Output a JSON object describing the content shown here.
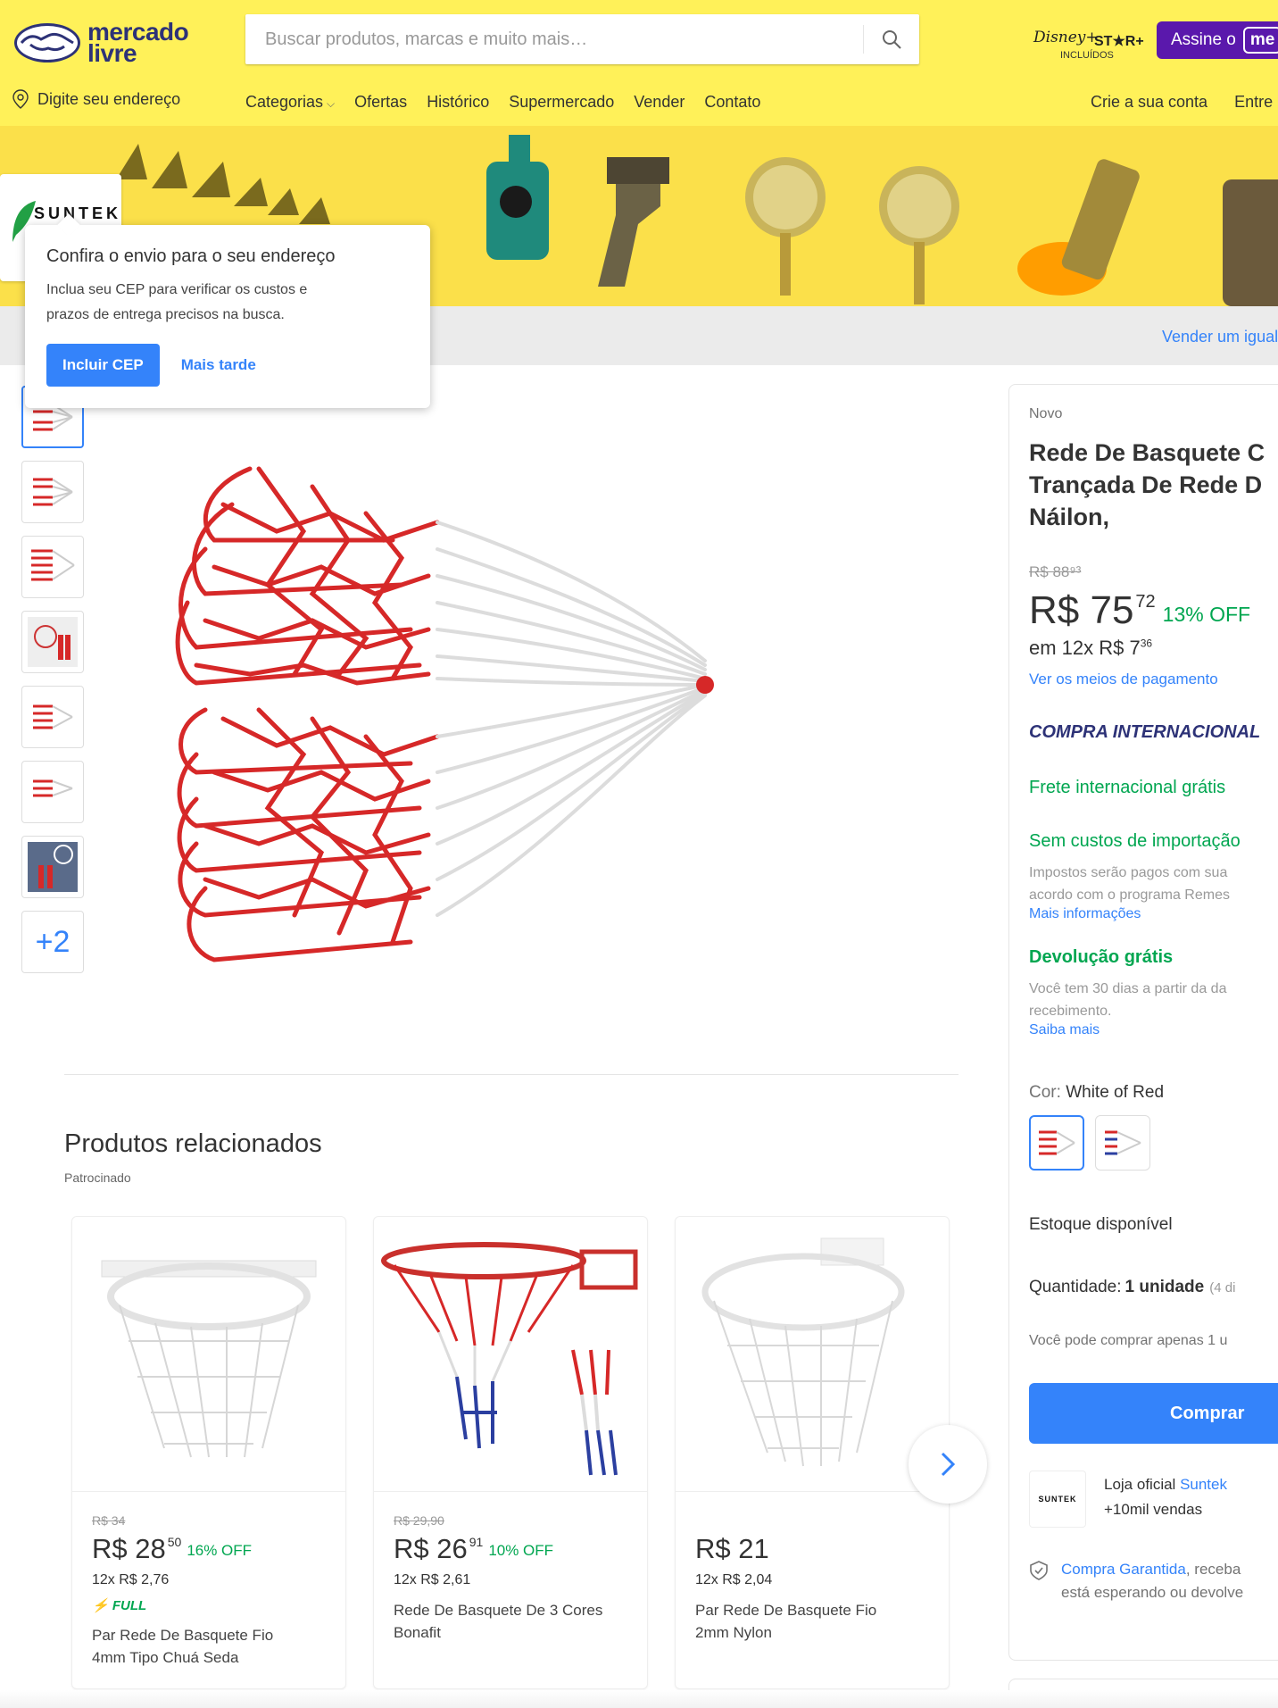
{
  "header": {
    "logo_line1": "mercado",
    "logo_line2": "livre",
    "search_placeholder": "Buscar produtos, marcas e muito mais…",
    "disney_brand": "Disney+",
    "star_brand": "ST★R+",
    "included": "INCLUÍDOS",
    "subscribe_label": "Assine o",
    "subscribe_badge": "me",
    "location_label": "Digite seu endereço",
    "nav": [
      "Categorias",
      "Ofertas",
      "Histórico",
      "Supermercado",
      "Vender",
      "Contato"
    ],
    "create_account": "Crie a sua conta",
    "login": "Entre"
  },
  "banner": {
    "store_name": "SUNTEK",
    "sell_similar": "Vender um igual"
  },
  "popup": {
    "title": "Confira o envio para o seu endereço",
    "text_line1": "Inclua seu CEP para verificar os custos e",
    "text_line2": "prazos de entrega precisos na busca.",
    "primary_button": "Incluir CEP",
    "secondary_button": "Mais tarde"
  },
  "gallery": {
    "more_count": "+2"
  },
  "related": {
    "title": "Produtos relacionados",
    "sponsored": "Patrocinado",
    "items": [
      {
        "old_price": "R$ 34",
        "price_int": "R$ 28",
        "price_cents": "50",
        "off": "16% OFF",
        "installments": "12x R$ 2,76",
        "full": "FULL",
        "name_line1": "Par Rede De Basquete Fio",
        "name_line2": "4mm Tipo Chuá Seda"
      },
      {
        "old_price": "R$ 29,90",
        "price_int": "R$ 26",
        "price_cents": "91",
        "off": "10% OFF",
        "installments": "12x R$ 2,61",
        "full": "",
        "name_line1": "Rede De Basquete De 3 Cores",
        "name_line2": "Bonafit"
      },
      {
        "old_price": "",
        "price_int": "R$ 21",
        "price_cents": "",
        "off": "",
        "installments": "12x R$ 2,04",
        "full": "",
        "name_line1": "Par Rede De Basquete Fio",
        "name_line2": "2mm Nylon"
      }
    ]
  },
  "product": {
    "condition": "Novo",
    "title_line1": "Rede De Basquete C",
    "title_line2": "Trançada De Rede D",
    "title_line3": "Náilon,",
    "old_price": "R$ 88⁹³",
    "price_int": "R$ 75",
    "price_cents": "72",
    "off": "13% OFF",
    "installments": "em 12x R$ 7",
    "installments_cents": "36",
    "payment_link": "Ver os meios de pagamento",
    "international": "COMPRA INTERNACIONAL",
    "free_shipping": "Frete internacional grátis",
    "no_import_costs": "Sem custos de importação",
    "taxes_line1": "Impostos serão pagos com sua",
    "taxes_line2": "acordo com o programa Remes",
    "more_info": "Mais informações",
    "free_return": "Devolução grátis",
    "return_line1": "Você tem 30 dias a partir da da",
    "return_line2": "recebimento.",
    "learn_more": "Saiba mais",
    "color_label": "Cor:",
    "color_value": "White of Red",
    "stock": "Estoque disponível",
    "qty_label": "Quantidade:",
    "qty_value": "1 unidade",
    "qty_available": "(4 di",
    "buy_limit": "Você pode comprar apenas 1 u",
    "buy_button": "Comprar",
    "seller_logo": "SUNTEK",
    "official_store": "Loja oficial",
    "store_name": "Suntek",
    "sales": "+10mil vendas",
    "guarantee_link": "Compra Garantida",
    "guarantee_line1": ", receba",
    "guarantee_line2": "está esperando ou devolve"
  },
  "colors": {
    "header_yellow": "#fff159",
    "brand_blue": "#3483fa",
    "offer_green": "#00a650",
    "logo_navy": "#2d3277",
    "net_red": "#d62828"
  }
}
